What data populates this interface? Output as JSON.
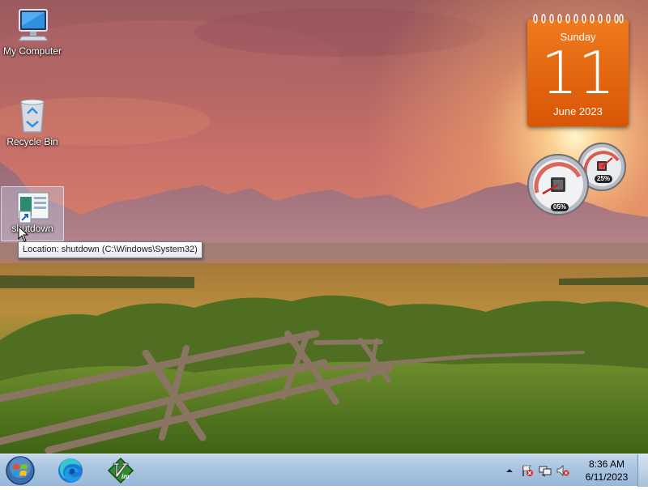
{
  "desktop": {
    "icons": [
      {
        "label": "My Computer",
        "icon": "computer-icon"
      },
      {
        "label": "Recycle Bin",
        "icon": "recycle-bin-icon"
      },
      {
        "label": "shutdown",
        "icon": "shortcut-icon",
        "selected": true
      }
    ],
    "tooltip": "Location: shutdown (C:\\Windows\\System32)"
  },
  "gadgets": {
    "calendar": {
      "weekday": "Sunday",
      "date": "11",
      "month_year": "June 2023",
      "color": "#e8680f"
    },
    "cpu_meter": {
      "cpu_percent": "05%",
      "memory_percent": "25%",
      "cpu_value": 5,
      "memory_value": 25
    }
  },
  "taskbar": {
    "start_button": "windows-start-icon",
    "pinned": [
      {
        "name": "edge",
        "icon": "edge-browser-icon"
      },
      {
        "name": "vim",
        "icon": "vim-icon"
      }
    ],
    "tray": {
      "icons": [
        "show-hidden-icons-arrow",
        "action-center-flag-icon",
        "network-icon",
        "volume-muted-icon"
      ],
      "time": "8:36 AM",
      "date": "6/11/2023"
    }
  }
}
